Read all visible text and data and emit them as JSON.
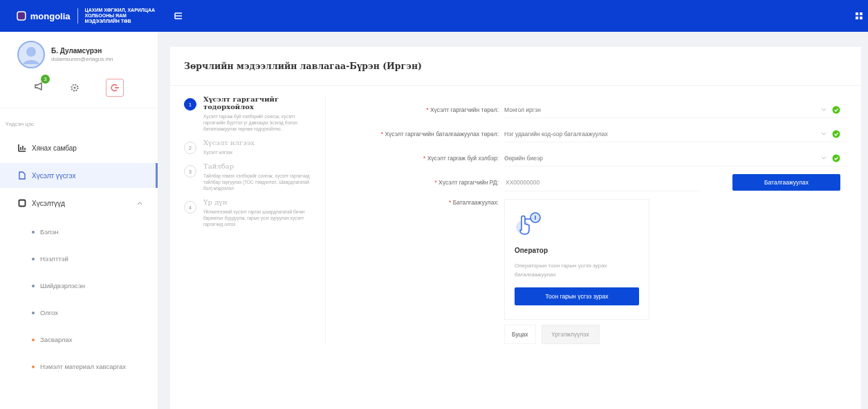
{
  "header": {
    "logo": "mongolia",
    "tagline": [
      "ЦАХИМ ХӨГЖИЛ, ХАРИЛЦАА",
      "ХОЛБООНЫ ЯАМ",
      "МЭДЭЭЛЛИЙН ТӨВ"
    ]
  },
  "user": {
    "name": "Б. Дуламсүрэн",
    "email": "dulamsuren@erlagus.mn",
    "notifications": "3"
  },
  "sidebar": {
    "section": "Үндсэн цэс",
    "items": [
      {
        "label": "Хянах самбар",
        "selected": false
      },
      {
        "label": "Хүсэлт үүсгэх",
        "selected": true
      },
      {
        "label": "Хүсэлтүүд",
        "selected": false,
        "expanded": true,
        "children": [
          {
            "label": "Бэлэн",
            "color": "#7c8fa8"
          },
          {
            "label": "Нээлттэй",
            "color": "#7c8fa8"
          },
          {
            "label": "Шийдвэрлэсэн",
            "color": "#7c8fa8"
          },
          {
            "label": "Олгох",
            "color": "#7c8fa8"
          },
          {
            "label": "Засварлах",
            "color": "#f08a4b"
          },
          {
            "label": "Нэмэлт материал хавсаргах",
            "color": "#f08a4b"
          }
        ]
      }
    ]
  },
  "page": {
    "title": "Зөрчлийн мэдээллийн лавлагаа-Бүрэн (Иргэн)"
  },
  "steps": [
    {
      "number": "1",
      "title": "Хүсэлт гаргагчийг тодорхойлох",
      "description": "Хүсэлт гаргаж буй хэлбэрийг сонгож, хүсэлт гаргагчийн бүртгэл үг давхацах эсэхэд болон баталгаажуулах төрлөө тодорхойлно.",
      "selected": true
    },
    {
      "number": "2",
      "title": "Хүсэлт илгээх",
      "description": "Хүсэлт илгээх",
      "selected": false
    },
    {
      "number": "3",
      "title": "Тайлбар",
      "description": "Тайлбар нэмэх хэлбэрийг сонгож, хүсэлт гаргагчид тайлбар гаргуулах (ТОС тэмдэглэл, Шаардлагатай бол) мэдээлэл",
      "selected": false
    },
    {
      "number": "4",
      "title": "Үр дүн",
      "description": "Үйлчилгээний хүсэлт гаргах шаардлагатай бичиг баримтыг бүрдүүлж, гарын үсэг зуруулан хүсэлт гаргагчид олгох",
      "selected": false
    }
  ],
  "form": {
    "required_mark": "*",
    "fields": [
      {
        "kind": "select",
        "label": "Хүсэлт гаргагчийн төрөл:",
        "value": "Монгол иргэн",
        "valid": true
      },
      {
        "kind": "select",
        "label": "Хүсэлт гаргагчийн баталгаажуулах төрөл:",
        "value": "Нэг удаагийн код-оор баталгаажуулах",
        "valid": true
      },
      {
        "kind": "select",
        "label": "Хүсэлт гаргаж буй хэлбэр:",
        "value": "Өөрийн биеэр",
        "valid": true
      },
      {
        "kind": "input",
        "label": "Хүсэлт гаргагчийн РД:",
        "placeholder": "ХХ00000000",
        "button": "Баталгаажуулах"
      }
    ],
    "verify": {
      "label": "Баталгаажуулах:",
      "title": "Оператор",
      "text": "Операторын тоон гарын үсгээ зурах баталгаажуулах",
      "button": "Тоон гарын үсгээ зурах"
    },
    "back": "Буцах",
    "next": {
      "label": "Үргэлжлүүлэх",
      "disabled": true
    }
  }
}
